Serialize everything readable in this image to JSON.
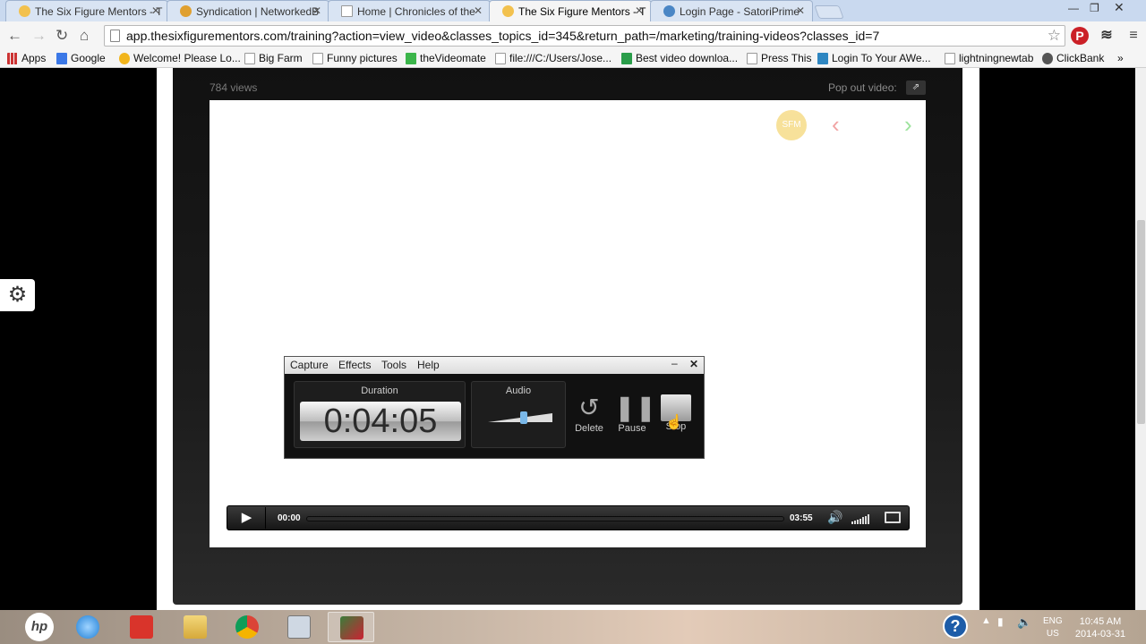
{
  "browser": {
    "tabs": [
      {
        "title": "The Six Figure Mentors - T",
        "fav": "#f2c14e",
        "active": false
      },
      {
        "title": "Syndication | NetworkedB",
        "fav": "#e0a030",
        "active": false
      },
      {
        "title": "Home | Chronicles of the",
        "fav": "#ffffff",
        "active": false
      },
      {
        "title": "The Six Figure Mentors - T",
        "fav": "#f2c14e",
        "active": true
      },
      {
        "title": "Login Page - SatoriPrime",
        "fav": "#4a86c5",
        "active": false
      }
    ],
    "url": "app.thesixfigurementors.com/training?action=view_video&classes_topics_id=345&return_path=/marketing/training-videos?classes_id=7",
    "bookmarks": [
      "Apps",
      "Google",
      "Welcome! Please Lo...",
      "Big Farm",
      "Funny pictures",
      "theVideomate",
      "file:///C:/Users/Jose...",
      "Best video downloa...",
      "Press This",
      "Login To Your AWe...",
      "lightningnewtab",
      "ClickBank"
    ]
  },
  "video_page": {
    "views": "784 views",
    "popout_label": "Pop out video:",
    "logo_text": "SFM"
  },
  "recorder": {
    "menu": [
      "Capture",
      "Effects",
      "Tools",
      "Help"
    ],
    "duration_label": "Duration",
    "duration": "0:04:05",
    "audio_label": "Audio",
    "buttons": {
      "delete": "Delete",
      "pause": "Pause",
      "stop": "Stop"
    }
  },
  "player": {
    "current_time": "00:00",
    "duration": "03:55",
    "progress": 0
  },
  "taskbar": {
    "lang_top": "ENG",
    "lang_bottom": "US",
    "time": "10:45 AM",
    "date": "2014-03-31"
  }
}
